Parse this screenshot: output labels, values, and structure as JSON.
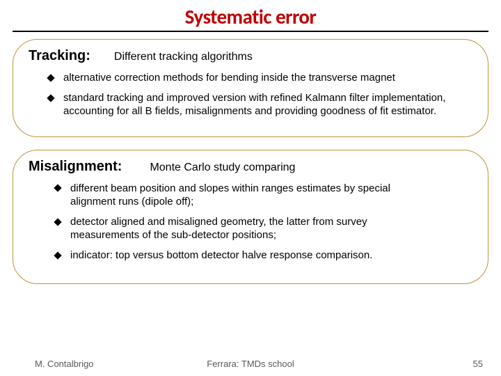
{
  "title": "Systematic error",
  "tracking": {
    "label": "Tracking:",
    "subtitle": "Different tracking algorithms",
    "items": [
      "alternative correction methods for bending inside the transverse magnet",
      "standard tracking and improved version with refined Kalmann filter implementation, accounting for all B fields, misalignments and providing goodness of fit estimator."
    ]
  },
  "misalignment": {
    "label": "Misalignment:",
    "subtitle": "Monte Carlo study comparing",
    "items": [
      "different beam position and slopes within ranges estimates by special alignment runs (dipole off);",
      "detector aligned and misaligned geometry, the latter from survey measurements of the sub-detector positions;",
      "indicator: top versus bottom detector halve response comparison."
    ]
  },
  "footer": {
    "left": "M. Contalbrigo",
    "center": "Ferrara: TMDs school",
    "right": "55"
  }
}
